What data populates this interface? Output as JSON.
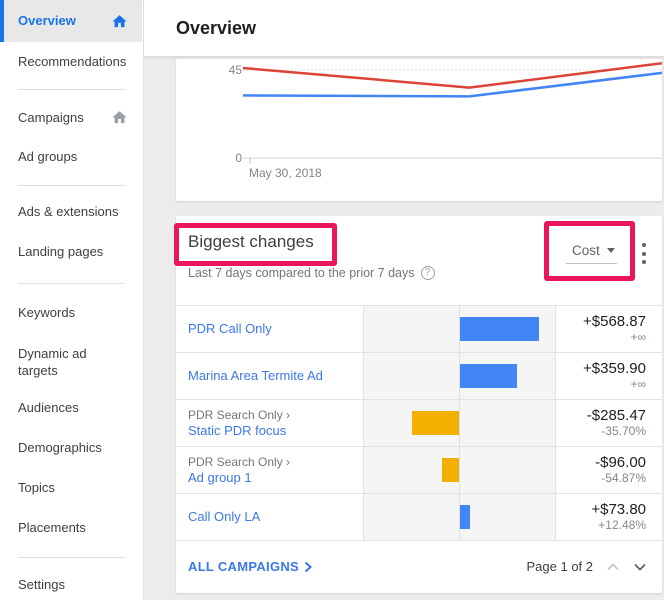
{
  "header": {
    "title": "Overview"
  },
  "sidebar": {
    "items": [
      {
        "label": "Overview",
        "selected": true,
        "icon": "home-icon"
      },
      {
        "label": "Recommendations"
      },
      {
        "label": "Campaigns",
        "icon": "home-icon"
      },
      {
        "label": "Ad groups"
      },
      {
        "label": "Ads & extensions"
      },
      {
        "label": "Landing pages"
      },
      {
        "label": "Keywords"
      },
      {
        "label": "Dynamic ad targets"
      },
      {
        "label": "Audiences"
      },
      {
        "label": "Demographics"
      },
      {
        "label": "Topics"
      },
      {
        "label": "Placements"
      },
      {
        "label": "Settings"
      }
    ]
  },
  "chart_data": {
    "type": "line",
    "y_ticks": [
      {
        "label": "45",
        "value": 45
      },
      {
        "label": "0",
        "value": 0
      }
    ],
    "x_tick_label": "May 30, 2018",
    "ylim": [
      0,
      50
    ],
    "grid": "dotted line at 45, solid baseline at 0",
    "series": [
      {
        "name": "blue-series",
        "color": "#4285f4",
        "points": [
          {
            "x": 0,
            "y": 32
          },
          {
            "x": 0.54,
            "y": 31.5
          },
          {
            "x": 1,
            "y": 43.5
          }
        ]
      },
      {
        "name": "red-series",
        "color": "#dc4437",
        "points": [
          {
            "x": 0,
            "y": 46
          },
          {
            "x": 0.54,
            "y": 36
          },
          {
            "x": 1,
            "y": 48.5
          }
        ]
      }
    ]
  },
  "changes": {
    "title": "Biggest changes",
    "subtitle": "Last 7 days compared to the prior 7 days",
    "help_symbol": "?",
    "metric_selector_label": "Cost",
    "rows": [
      {
        "parent": "",
        "name": "PDR Call Only",
        "value": "+$568.87",
        "pct": "+∞",
        "bar": {
          "dir": "pos",
          "width": 79,
          "color": "#4285f4"
        }
      },
      {
        "parent": "",
        "name": "Marina Area Termite Ad",
        "value": "+$359.90",
        "pct": "+∞",
        "bar": {
          "dir": "pos",
          "width": 57,
          "color": "#4285f4"
        }
      },
      {
        "parent": "PDR Search Only ›",
        "name": "Static PDR focus",
        "value": "-$285.47",
        "pct": "-35.70%",
        "bar": {
          "dir": "neg",
          "width": 47,
          "color": "#f3b000"
        }
      },
      {
        "parent": "PDR Search Only ›",
        "name": "Ad group 1",
        "value": "-$96.00",
        "pct": "-54.87%",
        "bar": {
          "dir": "neg",
          "width": 17,
          "color": "#f3b000"
        }
      },
      {
        "parent": "",
        "name": "Call Only LA",
        "value": "+$73.80",
        "pct": "+12.48%",
        "bar": {
          "dir": "pos",
          "width": 10,
          "color": "#4285f4"
        }
      }
    ],
    "footer": {
      "link_label": "ALL CAMPAIGNS",
      "page_label": "Page 1 of 2"
    }
  },
  "annotation_color": "#ea1659"
}
